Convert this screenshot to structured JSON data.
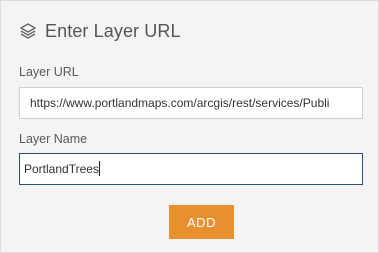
{
  "header": {
    "icon": "layers-icon",
    "title": "Enter Layer URL"
  },
  "fields": {
    "url_label": "Layer URL",
    "url_value": "https://www.portlandmaps.com/arcgis/rest/services/Publi",
    "name_label": "Layer Name",
    "name_value": "PortlandTrees"
  },
  "actions": {
    "add_label": "ADD"
  },
  "colors": {
    "accent": "#e8902f",
    "focus_border": "#2b4f7e",
    "panel_bg": "#f4f4f4"
  }
}
